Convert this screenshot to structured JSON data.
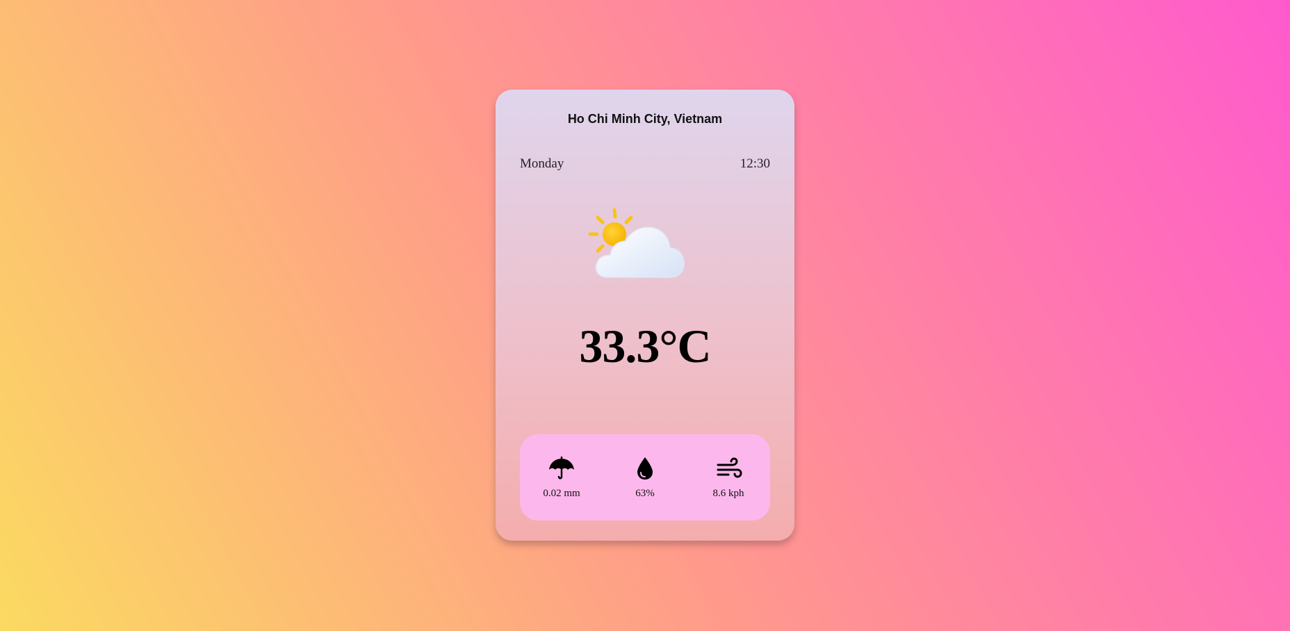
{
  "card": {
    "location": "Ho Chi Minh City, Vietnam",
    "day": "Monday",
    "time": "12:30",
    "condition_icon": "partly-cloudy-icon",
    "temperature": "33.3°C"
  },
  "stats": [
    {
      "icon": "umbrella-icon",
      "value": "0.02 mm"
    },
    {
      "icon": "droplet-icon",
      "value": "63%"
    },
    {
      "icon": "wind-icon",
      "value": "8.6 kph"
    }
  ],
  "colors": {
    "background_start": "#fbda61",
    "background_end": "#ff5acd",
    "stats_panel": "#fcb8ec"
  }
}
